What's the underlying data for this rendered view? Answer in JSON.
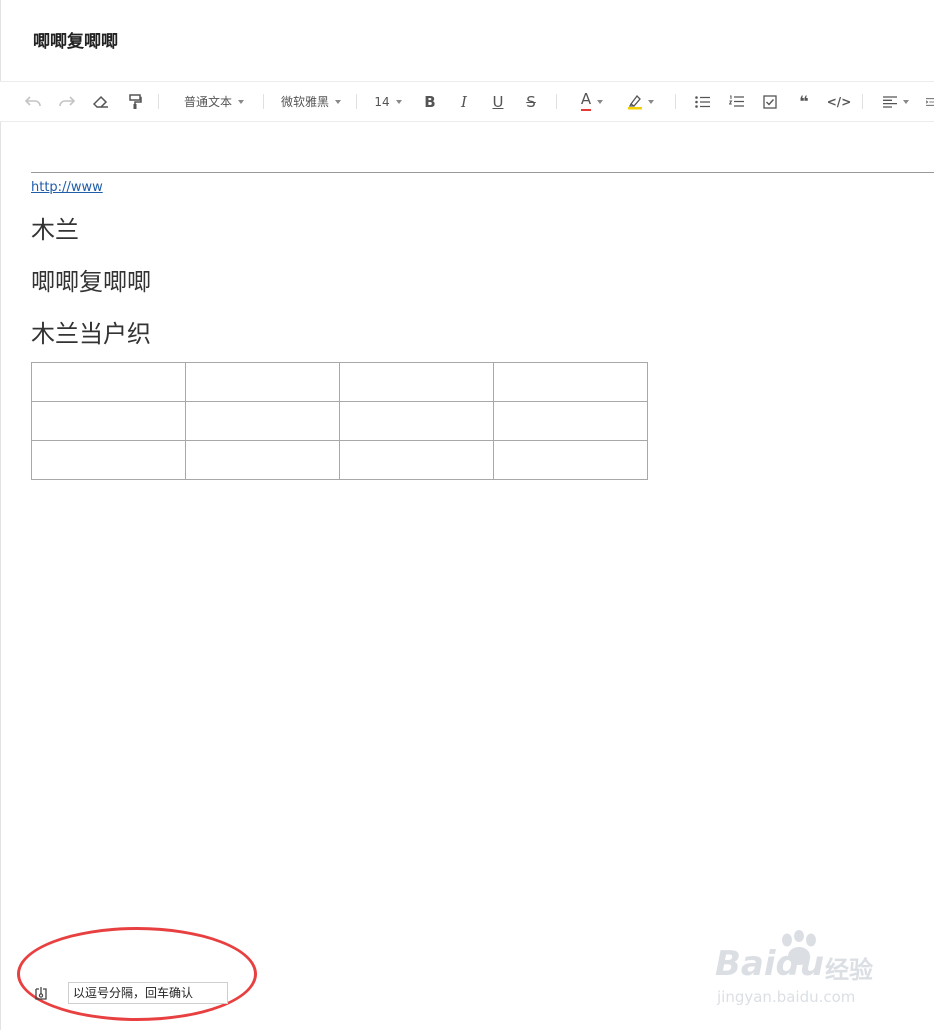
{
  "document": {
    "title": "唧唧复唧唧",
    "link_text": "http://www",
    "paragraphs": [
      "木兰",
      "唧唧复唧唧",
      "木兰当户织"
    ],
    "table": {
      "rows": 3,
      "cols": 4
    }
  },
  "toolbar": {
    "paragraph_style": "普通文本",
    "font_family": "微软雅黑",
    "font_size": "14",
    "bold": "B",
    "italic": "I",
    "underline": "U",
    "strike": "S",
    "font_color_letter": "A",
    "font_color": "#e53935",
    "highlight_color": "#f5d000",
    "quote": "❝",
    "code": "</>",
    "icons": [
      "undo-icon",
      "redo-icon",
      "eraser-icon",
      "format-painter-icon",
      "bullet-list-icon",
      "numbered-list-icon",
      "checkbox-list-icon",
      "quote-icon",
      "code-icon",
      "align-icon"
    ]
  },
  "tags": {
    "placeholder": "以逗号分隔，回车确认"
  },
  "watermark": {
    "brand": "Baidu",
    "product": "经验",
    "domain": "jingyan.baidu.com"
  }
}
